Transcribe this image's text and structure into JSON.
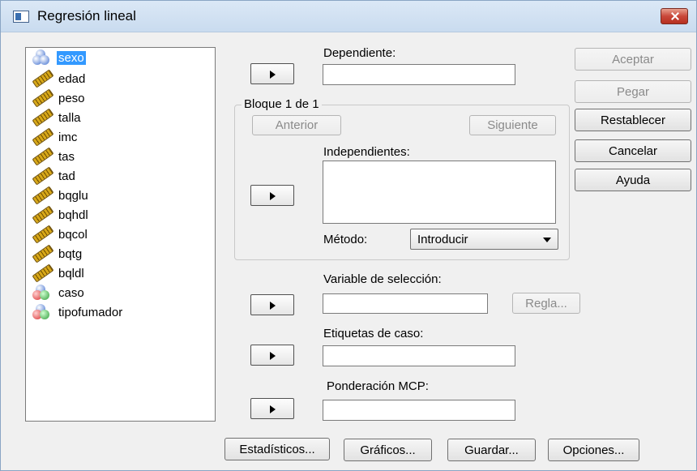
{
  "window": {
    "title": "Regresión lineal"
  },
  "variables": [
    {
      "name": "sexo",
      "icon": "nominal-balls-icon",
      "selected": true
    },
    {
      "name": "edad",
      "icon": "ruler-icon"
    },
    {
      "name": "peso",
      "icon": "ruler-icon"
    },
    {
      "name": "talla",
      "icon": "ruler-icon"
    },
    {
      "name": "imc",
      "icon": "ruler-icon"
    },
    {
      "name": "tas",
      "icon": "ruler-icon"
    },
    {
      "name": "tad",
      "icon": "ruler-icon"
    },
    {
      "name": "bqglu",
      "icon": "ruler-icon"
    },
    {
      "name": "bqhdl",
      "icon": "ruler-icon"
    },
    {
      "name": "bqcol",
      "icon": "ruler-icon"
    },
    {
      "name": "bqtg",
      "icon": "ruler-icon"
    },
    {
      "name": "bqldl",
      "icon": "ruler-icon"
    },
    {
      "name": "caso",
      "icon": "nominal-balls-icon"
    },
    {
      "name": "tipofumador",
      "icon": "nominal-balls-icon"
    }
  ],
  "dependent": {
    "label": "Dependiente:",
    "value": ""
  },
  "block": {
    "label": "Bloque 1 de 1",
    "previous": "Anterior",
    "next": "Siguiente",
    "independents_label": "Independientes:",
    "method_label": "Método:",
    "method_value": "Introducir"
  },
  "selection_variable": {
    "label": "Variable de selección:",
    "value": "",
    "rule_button": "Regla..."
  },
  "case_labels": {
    "label": "Etiquetas de caso:",
    "value": ""
  },
  "wls_weight": {
    "label": "Ponderación MCP:",
    "value": ""
  },
  "side_buttons": {
    "accept": "Aceptar",
    "paste": "Pegar",
    "reset": "Restablecer",
    "cancel": "Cancelar",
    "help": "Ayuda"
  },
  "bottom_buttons": {
    "statistics": "Estadísticos...",
    "plots": "Gráficos...",
    "save": "Guardar...",
    "options": "Opciones..."
  },
  "colors": {
    "selection": "#3399ff",
    "titlebar": "#c9dbef",
    "close": "#c9473a"
  }
}
